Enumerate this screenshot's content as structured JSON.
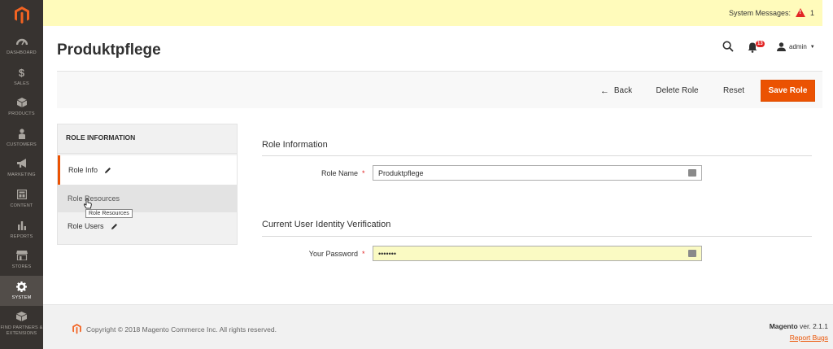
{
  "sidebar": {
    "items": [
      {
        "label": "DASHBOARD",
        "icon": "dashboard-icon"
      },
      {
        "label": "SALES",
        "icon": "dollar-icon"
      },
      {
        "label": "PRODUCTS",
        "icon": "cube-icon"
      },
      {
        "label": "CUSTOMERS",
        "icon": "person-icon"
      },
      {
        "label": "MARKETING",
        "icon": "megaphone-icon"
      },
      {
        "label": "CONTENT",
        "icon": "layout-icon"
      },
      {
        "label": "REPORTS",
        "icon": "bar-chart-icon"
      },
      {
        "label": "STORES",
        "icon": "store-icon"
      },
      {
        "label": "SYSTEM",
        "icon": "gear-icon"
      },
      {
        "label": "FIND PARTNERS & EXTENSIONS",
        "icon": "extensions-icon"
      }
    ]
  },
  "system_messages": {
    "label": "System Messages:",
    "count": "1"
  },
  "header": {
    "title": "Produktpflege",
    "notifications": "13",
    "user": "admin"
  },
  "actions": {
    "back": "Back",
    "delete": "Delete Role",
    "reset": "Reset",
    "save": "Save Role"
  },
  "tabs": {
    "title": "ROLE INFORMATION",
    "items": [
      {
        "label": "Role Info"
      },
      {
        "label": "Role Resources"
      },
      {
        "label": "Role Users"
      }
    ],
    "tooltip": "Role Resources"
  },
  "form": {
    "section1": "Role Information",
    "role_name_label": "Role Name",
    "role_name_value": "Produktpflege",
    "section2": "Current User Identity Verification",
    "password_label": "Your Password",
    "password_value": "•••••••"
  },
  "footer": {
    "copyright": "Copyright © 2018 Magento Commerce Inc. All rights reserved.",
    "brand": "Magento",
    "version": " ver. 2.1.1",
    "report": "Report Bugs"
  },
  "colors": {
    "accent": "#eb5202",
    "sidebar": "#373330",
    "required": "#e22626"
  }
}
